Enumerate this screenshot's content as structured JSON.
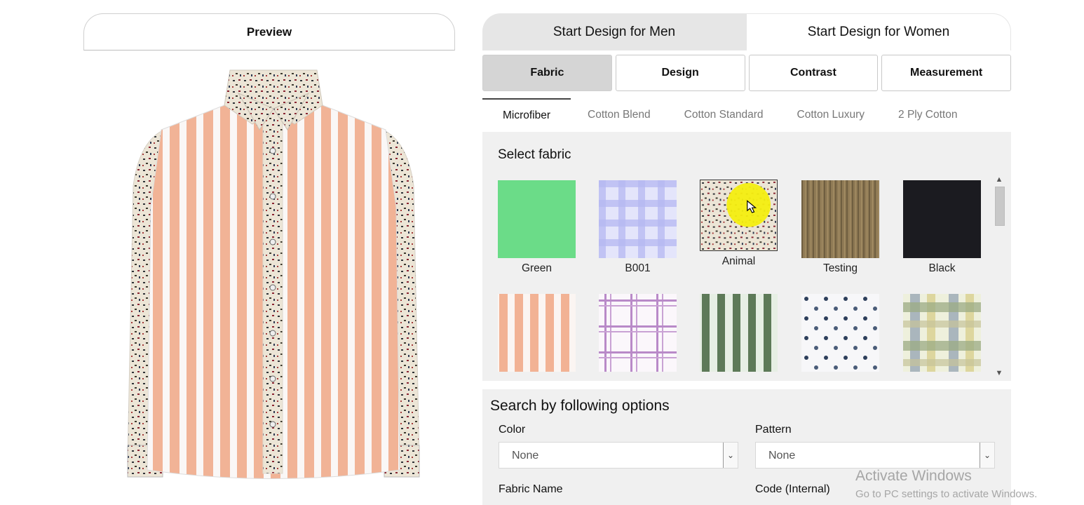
{
  "preview": {
    "title": "Preview"
  },
  "gender_tabs": [
    {
      "label": "Start Design for Men",
      "active": true
    },
    {
      "label": "Start Design for Women",
      "active": false
    }
  ],
  "main_tabs": [
    {
      "label": "Fabric",
      "active": true
    },
    {
      "label": "Design",
      "active": false
    },
    {
      "label": "Contrast",
      "active": false
    },
    {
      "label": "Measurement",
      "active": false
    }
  ],
  "fabric_tabs": [
    {
      "label": "Microfiber",
      "active": true
    },
    {
      "label": "Cotton Blend",
      "active": false
    },
    {
      "label": "Cotton Standard",
      "active": false
    },
    {
      "label": "Cotton Luxury",
      "active": false
    },
    {
      "label": "2 Ply Cotton",
      "active": false
    }
  ],
  "fabric_panel": {
    "title": "Select fabric",
    "swatches": [
      {
        "label": "Green",
        "pattern": "solid-green"
      },
      {
        "label": "B001",
        "pattern": "lavender-check"
      },
      {
        "label": "Animal",
        "pattern": "animal-print"
      },
      {
        "label": "Testing",
        "pattern": "wood-stripe"
      },
      {
        "label": "Black",
        "pattern": "solid-black"
      },
      {
        "label": "",
        "pattern": "peach-stripe"
      },
      {
        "label": "",
        "pattern": "purple-plaid"
      },
      {
        "label": "",
        "pattern": "green-stripe"
      },
      {
        "label": "",
        "pattern": "dot-print"
      },
      {
        "label": "",
        "pattern": "pastel-check"
      }
    ]
  },
  "search": {
    "title": "Search by following options",
    "color": {
      "label": "Color",
      "value": "None"
    },
    "pattern": {
      "label": "Pattern",
      "value": "None"
    },
    "fabric_name": {
      "label": "Fabric Name"
    },
    "code": {
      "label": "Code (Internal)"
    }
  },
  "watermark": {
    "line1": "Activate Windows",
    "line2": "Go to PC settings to activate Windows."
  },
  "colors": {
    "accent_gray": "#d5d5d5",
    "stripe_peach": "#f2b294",
    "green_swatch": "#6bdc88",
    "black_swatch": "#1b1b20"
  }
}
